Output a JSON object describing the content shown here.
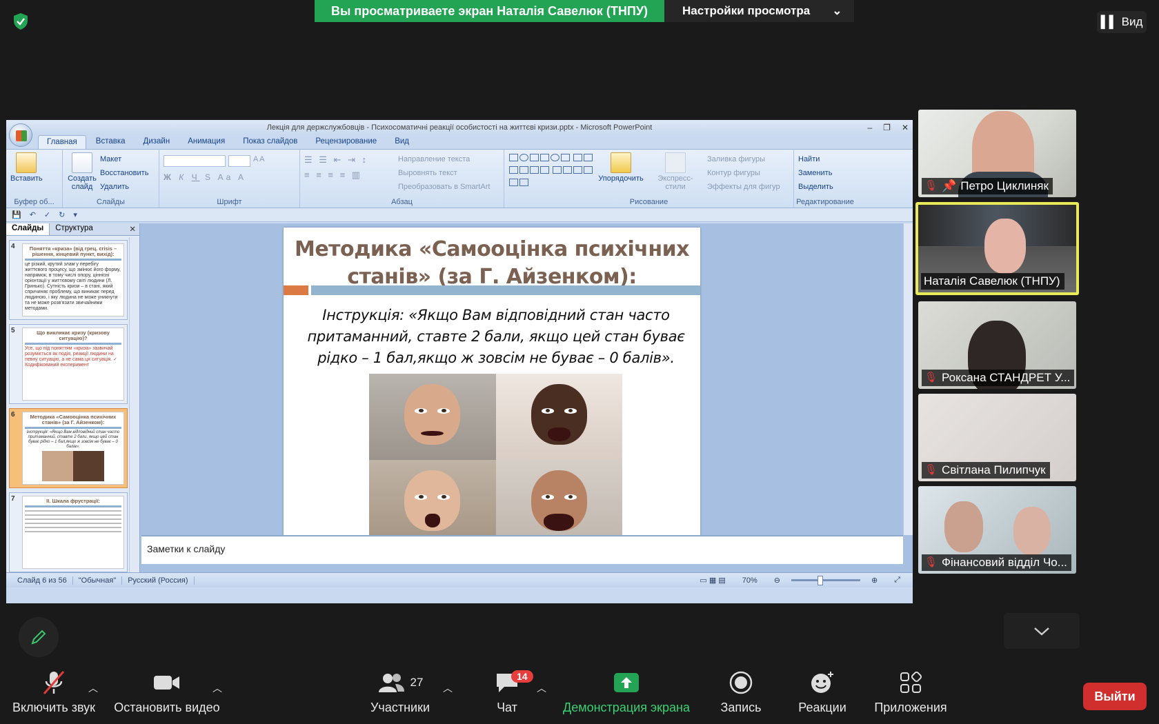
{
  "banner": {
    "sharing_text": "Вы просматриваете экран Наталія Савелюк (ТНПУ)",
    "view_settings": "Настройки просмотра"
  },
  "view_button": "Вид",
  "ppt": {
    "title": "Лекція для держслужбовців - Психосоматичні реакції особистості на життєві кризи.pptx - Microsoft PowerPoint",
    "tabs": [
      "Главная",
      "Вставка",
      "Дизайн",
      "Анимация",
      "Показ слайдов",
      "Рецензирование",
      "Вид"
    ],
    "ribbon": {
      "clipboard": {
        "paste": "Вставить",
        "label": "Буфер об..."
      },
      "slides": {
        "new_slide": "Создать слайд",
        "layout": "Макет",
        "reset": "Восстановить",
        "delete": "Удалить",
        "label": "Слайды"
      },
      "font": {
        "label": "Шрифт"
      },
      "paragraph": {
        "text_direction": "Направление текста",
        "align_text": "Выровнять текст",
        "smartart": "Преобразовать в SmartArt",
        "label": "Абзац"
      },
      "drawing": {
        "arrange": "Упорядочить",
        "quick_styles": "Экспресс-стили",
        "fill": "Заливка фигуры",
        "outline": "Контур фигуры",
        "effects": "Эффекты для фигур",
        "label": "Рисование"
      },
      "editing": {
        "find": "Найти",
        "replace": "Заменить",
        "select": "Выделить",
        "label": "Редактирование"
      }
    },
    "panel_tabs": {
      "slides": "Слайды",
      "outline": "Структура"
    },
    "thumbs": [
      {
        "num": "4",
        "title": "Поняття «криза» (від грец. crisis – рішення, кінцевий пункт, вихід):",
        "text": "це різкий, крутий злам у перебігу життєвого процесу, що змінює його форму, напрямок, в тому числі опору, ціннісні орієнтації у життєвому світі людини (Л. Гринько). Сутність кризи – в стані, який спричиняє проблему, що виникає перед людиною, і яку людина не може уникнути та не може розв'язати звичайними методами."
      },
      {
        "num": "5",
        "title": "Що викликає кризу (кризову ситуацію)?",
        "text": "Усе, що під поняттям «криза» зазвичай розуміється як подія, реакції людини на певну ситуацію, а не сама ця ситуація. ✓ Кодифікований експеримент"
      },
      {
        "num": "6",
        "title": "Методика «Самооцінка психічних станів» (за Г. Айзенком):",
        "text": "Інструкція: «Якщо Вам відповідний стан часто притаманний, ставте 2 бали, якщо цей стан буває рідко – 1 бал,якщо ж зовсім не буває – 0 балів»."
      },
      {
        "num": "7",
        "title": "ІІ. Шкала фрустрації:",
        "text": ""
      }
    ],
    "slide": {
      "title_line1": "Методика «Самооцінка психічних",
      "title_line2": "станів» (за Г. Айзенком):",
      "body": "Інструкція: «Якщо Вам відповідний стан часто притаманний, ставте 2 бали, якщо цей стан буває рідко – 1 бал,якщо ж зовсім не буває – 0 балів»."
    },
    "notes_placeholder": "Заметки к слайду",
    "status": {
      "slide": "Слайд 6 из 56",
      "theme": "\"Обычная\"",
      "language": "Русский (Россия)",
      "zoom": "70%"
    }
  },
  "participants": [
    {
      "name": "Петро Циклиняк",
      "muted": true,
      "pinned": true
    },
    {
      "name": "Наталія Савелюк (ТНПУ)",
      "muted": false,
      "active": true
    },
    {
      "name": "Роксана СТАНДРЕТ У...",
      "muted": true
    },
    {
      "name": "Світлана Пилипчук",
      "muted": true
    },
    {
      "name": "Фінансовий відділ Чо...",
      "muted": true
    }
  ],
  "toolbar": {
    "unmute": "Включить звук",
    "stop_video": "Остановить видео",
    "participants": "Участники",
    "participants_count": "27",
    "chat": "Чат",
    "chat_badge": "14",
    "share": "Демонстрация экрана",
    "record": "Запись",
    "reactions": "Реакции",
    "apps": "Приложения",
    "exit": "Выйти"
  },
  "colors": {
    "accent_green": "#23a455",
    "exit_red": "#d12e2e",
    "active_border": "#e8ea57"
  }
}
